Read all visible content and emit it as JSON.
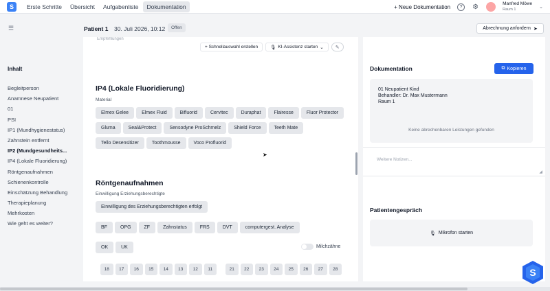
{
  "topbar": {
    "logo": "S",
    "nav": [
      "Erste Schritte",
      "Übersicht",
      "Aufgabenliste",
      "Dokumentation"
    ],
    "new_doc": "+ Neue Dokumentation",
    "help_icon": "?",
    "settings_icon": "⚙",
    "user_name": "Manfred Möwe",
    "user_room": "Raum 1"
  },
  "subbar": {
    "patient": "Patient 1",
    "date": "30. Juli 2026, 10:12",
    "status": "Offen",
    "abrechnung": "Abrechnung anfordern"
  },
  "sidebar": {
    "title": "Inhalt",
    "items": [
      "Begleitperson",
      "Anamnese Neupatient",
      "01",
      "PSI",
      "IP1 (Mundhygienestatus)",
      "Zahnstein entfernt",
      "IP2 (Mundgesundheits...",
      "IP4 (Lokale Fluoridierung)",
      "Röntgenaufnahmen",
      "Schienenkontrolle",
      "Einschätzung Behandlung",
      "Therapieplanung",
      "Mehrkosten",
      "Wie geht es weiter?"
    ],
    "active_index": 6
  },
  "main": {
    "top_text": "Empfehlungen",
    "schnellauswahl": "+ Schnellauswahl erstellen",
    "ki_assistenz": "KI-Assistenz starten",
    "ip4_title": "IP4 (Lokale Fluoridierung)",
    "material_label": "Material",
    "material_rows": [
      [
        "Elmex Gelee",
        "Elmex Fluid",
        "Bifluorid",
        "Cervitec",
        "Duraphat",
        "Flairesse",
        "Fluor Protector"
      ],
      [
        "Gluma",
        "Seal&Protect",
        "Sensodyne ProSchmelz",
        "Shield Force",
        "Teeth Mate"
      ],
      [
        "Tello Desensitizer",
        "Toothmousse",
        "Voco Profluorid"
      ]
    ],
    "roentgen_title": "Röntgenaufnahmen",
    "consent_label": "Einwilligung Erziehungsberechtigte",
    "consent_button": "Einwilligung des Erziehungsberechtigten erfolgt",
    "xray_types": [
      "BF",
      "OPG",
      "ZF",
      "Zahnstatus",
      "FRS",
      "DVT",
      "computergest. Analyse"
    ],
    "jaws": [
      "OK",
      "UK"
    ],
    "milchzaehne": "Milchzähne",
    "teeth_left": [
      "18",
      "17",
      "16",
      "15",
      "14",
      "13",
      "12",
      "11"
    ],
    "teeth_right": [
      "21",
      "22",
      "23",
      "24",
      "25",
      "26",
      "27",
      "28"
    ]
  },
  "right": {
    "doc_title": "Dokumentation",
    "copy_button": "Kopieren",
    "doc_lines": [
      "01 Neupatient Kind",
      "Behandler: Dr. Max Mustermann",
      "Raum 1"
    ],
    "no_services": "Keine abrechenbaren Leistungen gefunden",
    "notes_placeholder": "Weitere Notizen...",
    "gespraech_title": "Patientengespräch",
    "mic_button": "Mikrofon starten"
  },
  "colors": {
    "accent": "#2563eb",
    "chip_bg": "#e5e7eb"
  }
}
